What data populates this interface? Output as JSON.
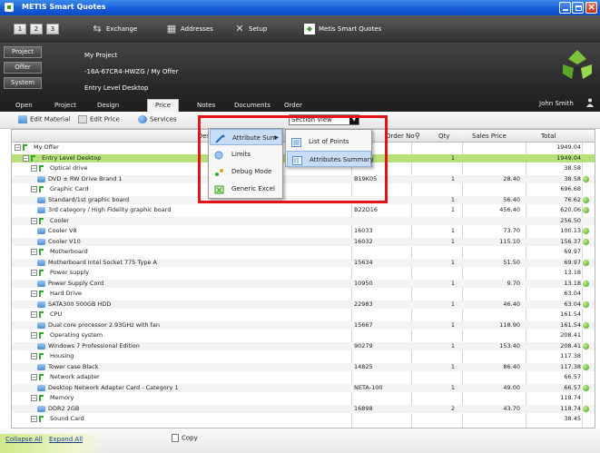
{
  "window": {
    "title": "METIS Smart Quotes"
  },
  "toolbar": {
    "steps": [
      "1",
      "2",
      "3"
    ],
    "exchange": "Exchange",
    "addresses": "Addresses",
    "setup": "Setup",
    "metis_quotes": "Metis Smart Quotes"
  },
  "header": {
    "side_buttons": [
      "Project",
      "Offer",
      "System"
    ],
    "project_name": "My Project",
    "offer_code": "-16A-67CR4-HWZG / My Offer",
    "system_name": "Entry Level Desktop",
    "user": "John Smith"
  },
  "tabs": [
    "Open",
    "Project",
    "Design",
    "Price",
    "Notes",
    "Documents",
    "Order"
  ],
  "active_tab": "Price",
  "subbar": {
    "edit_material": "Edit Material",
    "edit_price": "Edit Price",
    "services": "Services",
    "section_view": "Section View"
  },
  "columns": {
    "description": "Description",
    "order_no": "Order No",
    "qty": "Qty",
    "sales_price": "Sales Price",
    "total": "Total"
  },
  "rows": [
    {
      "indent": 0,
      "kind": "root",
      "label": "My Offer",
      "order": "",
      "qty": "",
      "sales": "",
      "total": "1949.04",
      "ok": false
    },
    {
      "indent": 1,
      "kind": "system",
      "label": "Entry Level Desktop",
      "order": "",
      "qty": "1",
      "sales": "",
      "total": "1949.04",
      "ok": false,
      "hl": true
    },
    {
      "indent": 2,
      "kind": "group",
      "label": "Optical drive",
      "order": "",
      "qty": "",
      "sales": "",
      "total": "38.58",
      "ok": false
    },
    {
      "indent": 3,
      "kind": "item",
      "label": "DVD ± RW Drive Brand 1",
      "order": "B19K05",
      "qty": "1",
      "sales": "28.40",
      "total": "38.58",
      "ok": true
    },
    {
      "indent": 2,
      "kind": "group",
      "label": "Graphic Card",
      "order": "",
      "qty": "",
      "sales": "",
      "total": "696.68",
      "ok": false
    },
    {
      "indent": 3,
      "kind": "item",
      "label": "Standard/1st graphic board",
      "order": "",
      "qty": "1",
      "sales": "56.40",
      "total": "76.62",
      "ok": true
    },
    {
      "indent": 3,
      "kind": "item",
      "label": "3rd category / High Fidelity graphic board",
      "order": "B22D16",
      "qty": "1",
      "sales": "456.40",
      "total": "620.06",
      "ok": true
    },
    {
      "indent": 2,
      "kind": "group",
      "label": "Cooler",
      "order": "",
      "qty": "",
      "sales": "",
      "total": "256.50",
      "ok": false
    },
    {
      "indent": 3,
      "kind": "item",
      "label": "Cooler V8",
      "order": "16033",
      "qty": "1",
      "sales": "73.70",
      "total": "100.13",
      "ok": true
    },
    {
      "indent": 3,
      "kind": "item",
      "label": "Cooler V10",
      "order": "16032",
      "qty": "1",
      "sales": "115.10",
      "total": "156.37",
      "ok": true
    },
    {
      "indent": 2,
      "kind": "group",
      "label": "Motherboard",
      "order": "",
      "qty": "",
      "sales": "",
      "total": "69.97",
      "ok": false
    },
    {
      "indent": 3,
      "kind": "item",
      "label": "Motherboard Intel Socket 775 Type A",
      "order": "15634",
      "qty": "1",
      "sales": "51.50",
      "total": "69.97",
      "ok": true
    },
    {
      "indent": 2,
      "kind": "group",
      "label": "Power supply",
      "order": "",
      "qty": "",
      "sales": "",
      "total": "13.18",
      "ok": false
    },
    {
      "indent": 3,
      "kind": "item",
      "label": "Power Supply Cord",
      "order": "10950",
      "qty": "1",
      "sales": "9.70",
      "total": "13.18",
      "ok": true
    },
    {
      "indent": 2,
      "kind": "group",
      "label": "Hard Drive",
      "order": "",
      "qty": "",
      "sales": "",
      "total": "63.04",
      "ok": false
    },
    {
      "indent": 3,
      "kind": "item",
      "label": "SATA300 500GB HDD",
      "order": "22983",
      "qty": "1",
      "sales": "46.40",
      "total": "63.04",
      "ok": true
    },
    {
      "indent": 2,
      "kind": "group",
      "label": "CPU",
      "order": "",
      "qty": "",
      "sales": "",
      "total": "161.54",
      "ok": false
    },
    {
      "indent": 3,
      "kind": "item",
      "label": "Dual core processor 2.93GHz with fan",
      "order": "15667",
      "qty": "1",
      "sales": "118.90",
      "total": "161.54",
      "ok": true
    },
    {
      "indent": 2,
      "kind": "group",
      "label": "Operating system",
      "order": "",
      "qty": "",
      "sales": "",
      "total": "208.41",
      "ok": false
    },
    {
      "indent": 3,
      "kind": "item",
      "label": "Windows 7 Professional Edition",
      "order": "90279",
      "qty": "1",
      "sales": "153.40",
      "total": "208.41",
      "ok": true
    },
    {
      "indent": 2,
      "kind": "group",
      "label": "Housing",
      "order": "",
      "qty": "",
      "sales": "",
      "total": "117.38",
      "ok": false
    },
    {
      "indent": 3,
      "kind": "item",
      "label": "Tower case Black",
      "order": "14825",
      "qty": "1",
      "sales": "86.40",
      "total": "117.38",
      "ok": true
    },
    {
      "indent": 2,
      "kind": "group",
      "label": "Network adapter",
      "order": "",
      "qty": "",
      "sales": "",
      "total": "66.57",
      "ok": false
    },
    {
      "indent": 3,
      "kind": "item",
      "label": "Desktop Network Adapter Card - Category 1",
      "order": "NETA-100",
      "qty": "1",
      "sales": "49.00",
      "total": "66.57",
      "ok": true
    },
    {
      "indent": 2,
      "kind": "group",
      "label": "Memory",
      "order": "",
      "qty": "",
      "sales": "",
      "total": "118.74",
      "ok": false
    },
    {
      "indent": 3,
      "kind": "item",
      "label": "DDR2 2GB",
      "order": "16898",
      "qty": "2",
      "sales": "43.70",
      "total": "118.74",
      "ok": true
    },
    {
      "indent": 2,
      "kind": "group",
      "label": "Sound Card",
      "order": "",
      "qty": "",
      "sales": "",
      "total": "38.45",
      "ok": false
    }
  ],
  "context_menu": {
    "items": [
      "Attribute Sum",
      "Limits",
      "Debug Mode",
      "Generic Excel"
    ],
    "selected": "Attribute Sum"
  },
  "sub_menu": {
    "items": [
      "List of Points",
      "Attributes Summary"
    ],
    "selected": "Attributes Summary"
  },
  "bottom": {
    "collapse_all": "Collapse All",
    "expand_all": "Expand All",
    "copy": "Copy"
  },
  "colors": {
    "highlight_row": "#b8e07a",
    "status_ok": "#3f9c1a",
    "annotation_box": "#e2141a",
    "titlebar": "#1659d6"
  }
}
